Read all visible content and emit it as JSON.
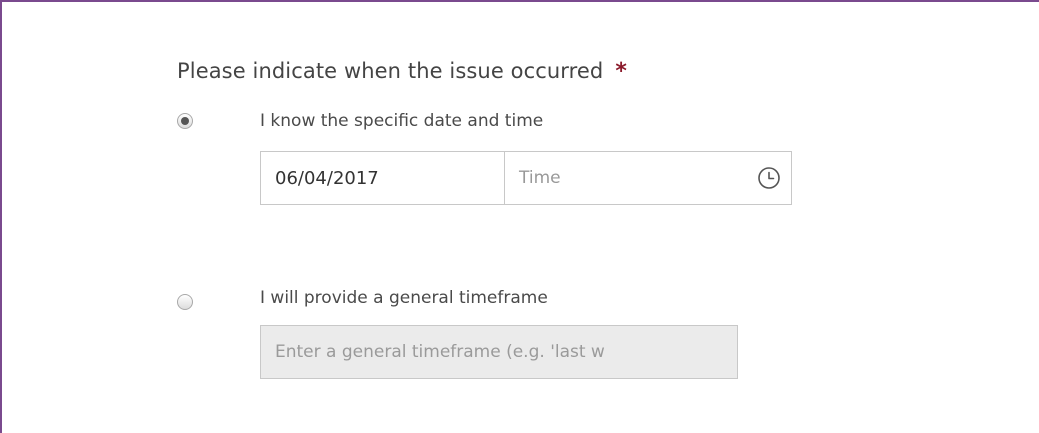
{
  "question": {
    "label": "Please indicate when the issue occurred",
    "required_marker": "*"
  },
  "option_specific": {
    "label": "I know the specific date and time",
    "selected": true,
    "date_value": "06/04/2017",
    "time_placeholder": "Time",
    "time_icon": "clock-icon"
  },
  "option_general": {
    "label": "I will provide a general timeframe",
    "selected": false,
    "timeframe_placeholder": "Enter a general timeframe (e.g. 'last w"
  },
  "colors": {
    "frame_border": "#7a4a8e",
    "required_star": "#8b1a2b",
    "disabled_field_bg": "#ebebeb"
  }
}
